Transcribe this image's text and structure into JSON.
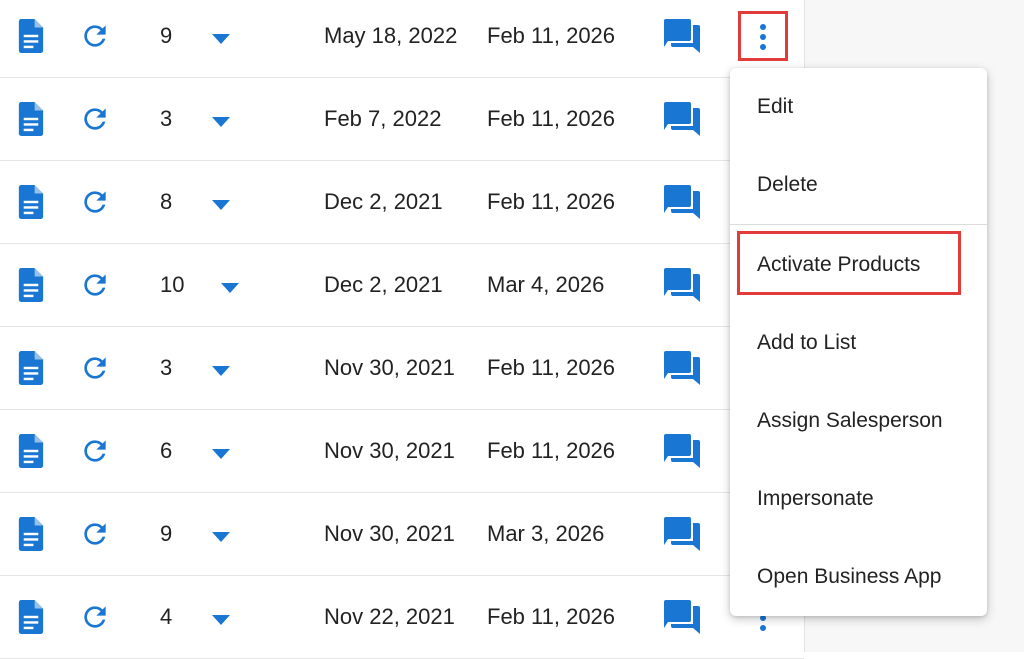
{
  "colors": {
    "accent": "#1976d2",
    "highlight": "#e23b3b",
    "text": "#222222",
    "divider": "#e6e6e6"
  },
  "rows": [
    {
      "quantity": "9",
      "created": "May 18, 2022",
      "updated": "Feb 11, 2026"
    },
    {
      "quantity": "3",
      "created": "Feb 7, 2022",
      "updated": "Feb 11, 2026"
    },
    {
      "quantity": "8",
      "created": "Dec 2, 2021",
      "updated": "Feb 11, 2026"
    },
    {
      "quantity": "10",
      "created": "Dec 2, 2021",
      "updated": "Mar 4, 2026"
    },
    {
      "quantity": "3",
      "created": "Nov 30, 2021",
      "updated": "Feb 11, 2026"
    },
    {
      "quantity": "6",
      "created": "Nov 30, 2021",
      "updated": "Feb 11, 2026"
    },
    {
      "quantity": "9",
      "created": "Nov 30, 2021",
      "updated": "Mar 3, 2026"
    },
    {
      "quantity": "4",
      "created": "Nov 22, 2021",
      "updated": "Feb 11, 2026"
    }
  ],
  "row_icons": [
    "document-icon",
    "refresh-icon",
    "dropdown-caret-icon",
    "chat-icon",
    "more-vert-icon"
  ],
  "context_menu": {
    "items": [
      {
        "label": "Edit"
      },
      {
        "label": "Delete"
      },
      {
        "label": "Activate Products"
      },
      {
        "label": "Add to List"
      },
      {
        "label": "Assign Salesperson"
      },
      {
        "label": "Impersonate"
      },
      {
        "label": "Open Business App"
      }
    ]
  }
}
